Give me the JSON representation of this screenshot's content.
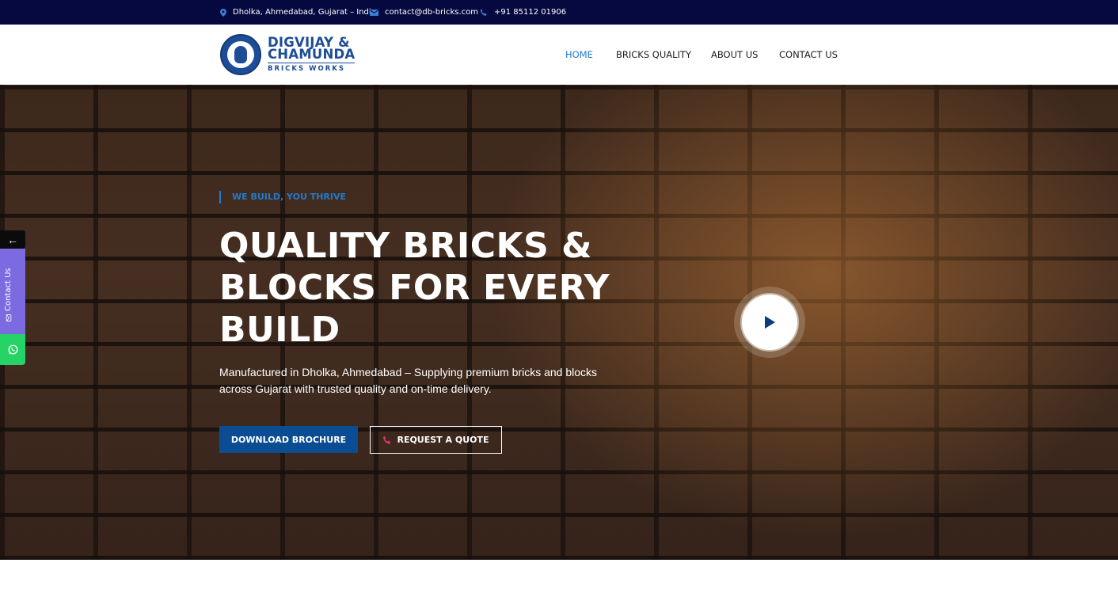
{
  "topbar": {
    "location": "Dholka, Ahmedabad, Gujarat – India",
    "email": "contact@db-bricks.com",
    "phone": "+91 85112 01906",
    "icons": [
      "map-pin-icon",
      "mail-icon",
      "phone-icon"
    ]
  },
  "logo": {
    "line1": "DIGVIJAY &",
    "line2": "CHAMUNDA",
    "line3": "BRICKS WORKS"
  },
  "nav": {
    "items": [
      {
        "label": "HOME",
        "active": true
      },
      {
        "label": "BRICKS QUALITY",
        "active": false
      },
      {
        "label": "ABOUT US",
        "active": false
      },
      {
        "label": "CONTACT US",
        "active": false
      }
    ]
  },
  "hero": {
    "tagline": "WE BUILD, YOU THRIVE",
    "headline": "QUALITY BRICKS & BLOCKS FOR EVERY BUILD",
    "subtext": "Manufactured in Dholka, Ahmedabad – Supplying premium bricks and blocks across Gujarat with trusted quality and on-time delivery.",
    "primary_button": "DOWNLOAD BROCHURE",
    "secondary_button": "REQUEST A QUOTE",
    "play_icon": "play-icon"
  },
  "side": {
    "arrow": "←",
    "contact_label": "Contact Us",
    "whatsapp_icon": "whatsapp-icon"
  },
  "colors": {
    "topbar_bg": "#06093f",
    "accent_blue": "#1f7bd0",
    "primary_button": "#0b4d92",
    "contact_tab": "#7b6ae0",
    "whatsapp": "#25d366",
    "phone_icon_pink": "#e0336b"
  }
}
